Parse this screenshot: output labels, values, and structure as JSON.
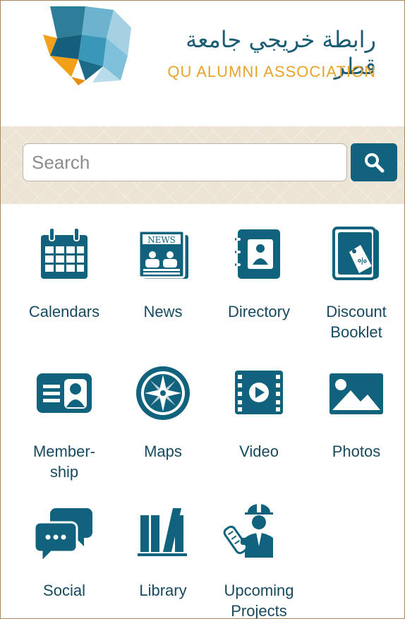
{
  "header": {
    "logo_arabic": "رابطة خريجي جامعة قطر",
    "logo_english": "QU ALUMNI ASSOCIATION"
  },
  "search": {
    "placeholder": "Search",
    "value": "",
    "button_icon": "search-icon"
  },
  "colors": {
    "primary": "#11627d",
    "accent": "#e7a32b",
    "label": "#174a5f",
    "band": "#ede4d6"
  },
  "grid": [
    {
      "label": "Calendars",
      "icon": "calendar-icon"
    },
    {
      "label": "News",
      "icon": "newspaper-icon"
    },
    {
      "label": "Directory",
      "icon": "address-book-icon"
    },
    {
      "label": "Discount\nBooklet",
      "icon": "discount-booklet-icon"
    },
    {
      "label": "Member-\nship",
      "icon": "membership-card-icon"
    },
    {
      "label": "Maps",
      "icon": "compass-icon"
    },
    {
      "label": "Video",
      "icon": "video-icon"
    },
    {
      "label": "Photos",
      "icon": "photo-icon"
    },
    {
      "label": "Social",
      "icon": "chat-bubbles-icon"
    },
    {
      "label": "Library",
      "icon": "books-icon"
    },
    {
      "label": "Upcoming\nProjects",
      "icon": "engineer-icon"
    }
  ]
}
